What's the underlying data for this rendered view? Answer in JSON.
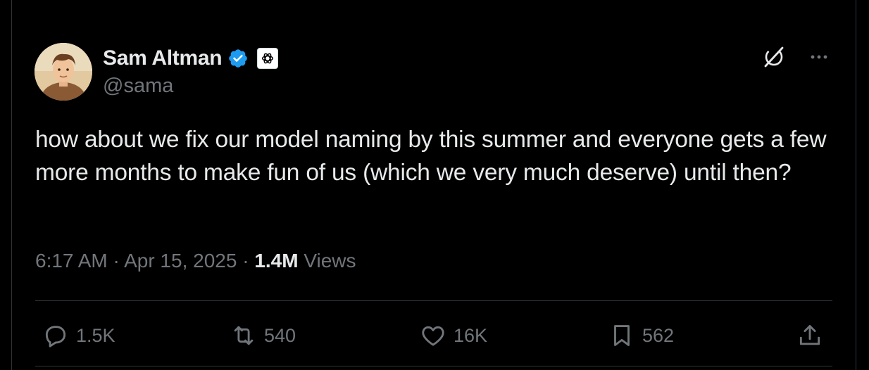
{
  "author": {
    "name": "Sam Altman",
    "handle": "@sama",
    "verified": true,
    "affiliation_icon": "openai-logo-icon"
  },
  "top_icons": [
    "grok-icon",
    "more-icon"
  ],
  "tweet": {
    "text": "how about we fix our model naming by this summer and everyone gets a few more months to make fun of us (which we very much deserve) until then?",
    "time": "6:17 AM",
    "separator": "·",
    "date": "Apr 15, 2025",
    "views_count": "1.4M",
    "views_label": "Views"
  },
  "actions": {
    "replies": "1.5K",
    "reposts": "540",
    "likes": "16K",
    "bookmarks": "562"
  },
  "colors": {
    "background": "#000000",
    "primary_text": "#e7e9ea",
    "secondary_text": "#71767b",
    "verified_blue": "#1d9bf0",
    "divider": "#2f3336"
  }
}
